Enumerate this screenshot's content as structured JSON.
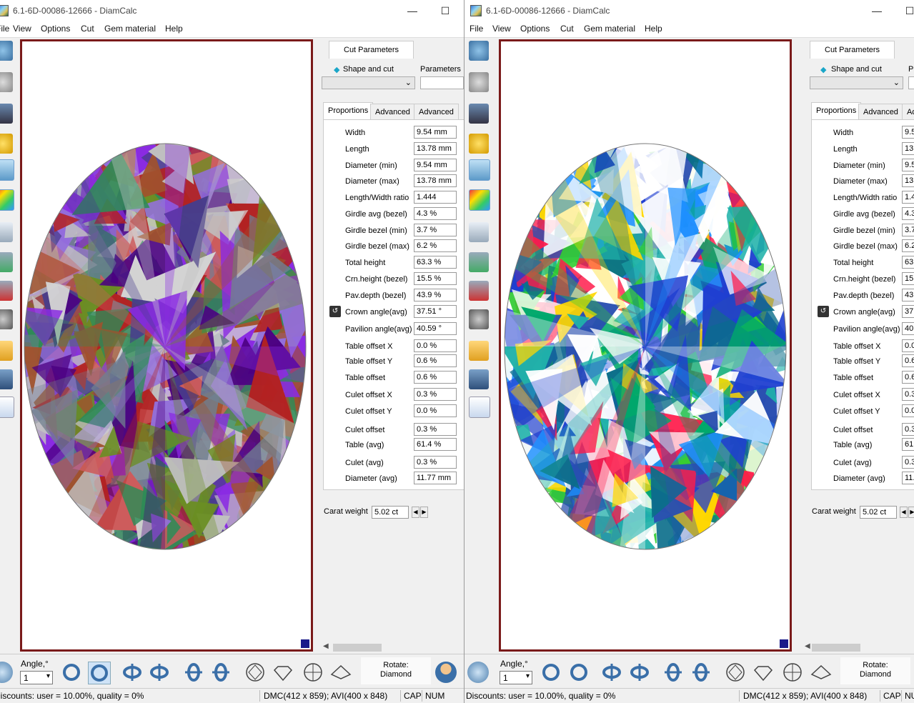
{
  "windows": [
    {
      "title": "6.1-6D-00086-12666 - DiamCalc",
      "menu": [
        "File",
        "View",
        "Options",
        "Cut",
        "Gem material",
        "Help"
      ],
      "gem_palette": [
        "#8a2be2",
        "#c0c0c0",
        "#a0522d",
        "#6b8e23",
        "#4b0082",
        "#b22222",
        "#9370db",
        "#708090",
        "#2e8b57",
        "#cd5c5c",
        "#483d8b",
        "#d3d3d3"
      ]
    },
    {
      "title": "6.1-6D-00086-12666 - DiamCalc",
      "menu": [
        "File",
        "View",
        "Options",
        "Cut",
        "Gem material",
        "Help"
      ],
      "gem_palette": [
        "#ffffff",
        "#1e90ff",
        "#00a86b",
        "#2a4fb0",
        "#ffffff",
        "#ff1a4a",
        "#20b2aa",
        "#1f3fd0",
        "#ffffff",
        "#32cd32",
        "#ffd700",
        "#0b6e8a"
      ]
    }
  ],
  "panel": {
    "tab": "Cut Parameters",
    "shape_and_cut": "Shape and cut",
    "parameters": "Parameters",
    "subtabs": [
      "Proportions",
      "Advanced",
      "Advanced"
    ],
    "rows": [
      {
        "label": "Width",
        "value": "9.54 mm"
      },
      {
        "label": "Length",
        "value": "13.78 mm"
      },
      {
        "label": "Diameter (min)",
        "value": "9.54 mm"
      },
      {
        "label": "Diameter (max)",
        "value": "13.78 mm"
      },
      {
        "label": "Length/Width ratio",
        "value": "1.444"
      },
      {
        "label": "Girdle avg (bezel)",
        "value": "4.3 %"
      },
      {
        "label": "Girdle bezel (min)",
        "value": "3.7 %"
      },
      {
        "label": "Girdle bezel (max)",
        "value": "6.2 %"
      },
      {
        "label": "Total height",
        "value": "63.3 %"
      },
      {
        "label": "Crn.height (bezel)",
        "value": "15.5 %"
      },
      {
        "label": "Pav.depth (bezel)",
        "value": "43.9 %"
      },
      {
        "label": "Crown angle(avg)",
        "value": "37.51 °"
      },
      {
        "label": "Pavilion angle(avg)",
        "value": "40.59 °"
      },
      {
        "label": "Table offset X",
        "value": "0.0 %"
      },
      {
        "label": "Table offset Y",
        "value": "0.6 %"
      },
      {
        "label": "Table offset",
        "value": "0.6 %"
      },
      {
        "label": "Culet offset X",
        "value": "0.3 %"
      },
      {
        "label": "Culet offset Y",
        "value": "0.0 %"
      },
      {
        "label": "Culet offset",
        "value": "0.3 %"
      },
      {
        "label": "Table (avg)",
        "value": "61.4 %"
      },
      {
        "label": "Culet (avg)",
        "value": "0.3 %"
      },
      {
        "label": "Diameter (avg)",
        "value": "11.77 mm"
      }
    ],
    "carat_label": "Carat weight",
    "carat_value": "5.02 ct"
  },
  "bottom": {
    "angle_label": "Angle,°",
    "angle_value": "1",
    "rotate_label": "Rotate:",
    "rotate_value": "Diamond"
  },
  "status": {
    "discounts": "Discounts: user = 10.00%, quality = 0%",
    "dmc": "DMC(412 x 859); AVI(400 x 848)",
    "cap": "CAP",
    "num": "NUM"
  }
}
